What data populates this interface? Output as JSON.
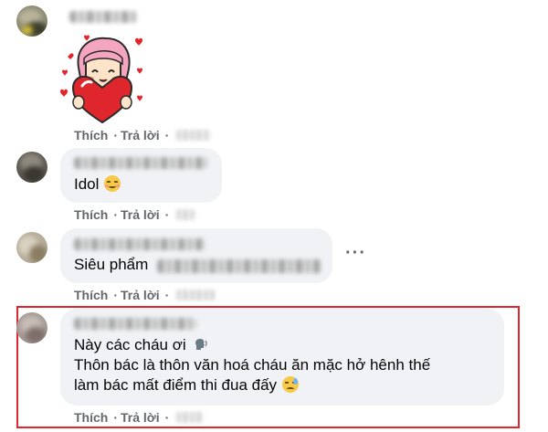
{
  "comments": [
    {
      "id": "c1",
      "sticker": "girl-hugging-heart-sticker",
      "actions": {
        "like": "Thích",
        "reply": "Trả lời"
      }
    },
    {
      "id": "c2",
      "text": "Idol",
      "emoji": "smiling-face-icon",
      "actions": {
        "like": "Thích",
        "reply": "Trả lời"
      }
    },
    {
      "id": "c3",
      "text": "Siêu phẩm",
      "actions": {
        "like": "Thích",
        "reply": "Trả lời"
      },
      "more_label": "···"
    },
    {
      "id": "c4",
      "lines": [
        "Này các cháu ơi",
        "Thôn bác là thôn văn hoá cháu ăn mặc hở hênh thế",
        "làm bác mất điểm thi đua đấy"
      ],
      "emojis": [
        "speaking-head-icon",
        "disappointed-face-icon"
      ],
      "actions": {
        "like": "Thích",
        "reply": "Trả lời"
      },
      "highlight_color": "#e0262d"
    }
  ],
  "colors": {
    "bubble": "#f0f2f5",
    "action_text": "#65676b",
    "text": "#050505"
  }
}
